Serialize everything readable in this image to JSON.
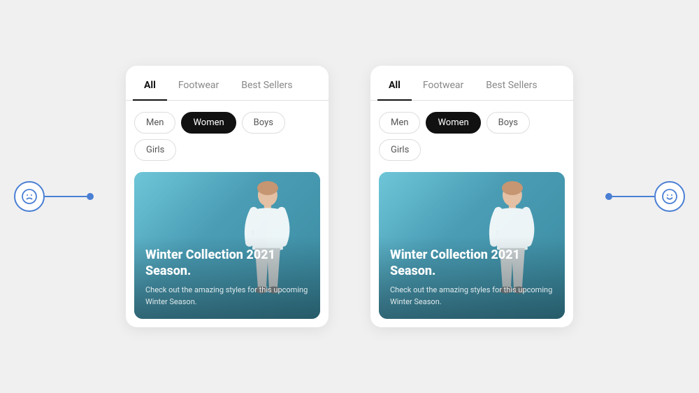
{
  "page": {
    "bg_color": "#f0f0f0",
    "accent_color": "#4a7fd4"
  },
  "panels": [
    {
      "id": "panel-left",
      "tabs": [
        {
          "label": "All",
          "active": true
        },
        {
          "label": "Footwear",
          "active": false
        },
        {
          "label": "Best Sellers",
          "active": false
        }
      ],
      "chips": [
        {
          "label": "Men",
          "active": false
        },
        {
          "label": "Women",
          "active": true
        },
        {
          "label": "Boys",
          "active": false
        },
        {
          "label": "Girls",
          "active": false
        }
      ],
      "card": {
        "title": "Winter Collection 2021 Season.",
        "description": "Check out the amazing styles for this upcoming Winter Season."
      }
    },
    {
      "id": "panel-right",
      "tabs": [
        {
          "label": "All",
          "active": true
        },
        {
          "label": "Footwear",
          "active": false
        },
        {
          "label": "Best Sellers",
          "active": false
        }
      ],
      "chips": [
        {
          "label": "Men",
          "active": false
        },
        {
          "label": "Women",
          "active": true
        },
        {
          "label": "Boys",
          "active": false
        },
        {
          "label": "Girls",
          "active": false
        }
      ],
      "card": {
        "title": "Winter Collection 2021 Season.",
        "description": "Check out the amazing styles for this upcoming Winter Season."
      }
    }
  ],
  "rating": {
    "left_icon": "☹",
    "right_icon": "☺"
  }
}
